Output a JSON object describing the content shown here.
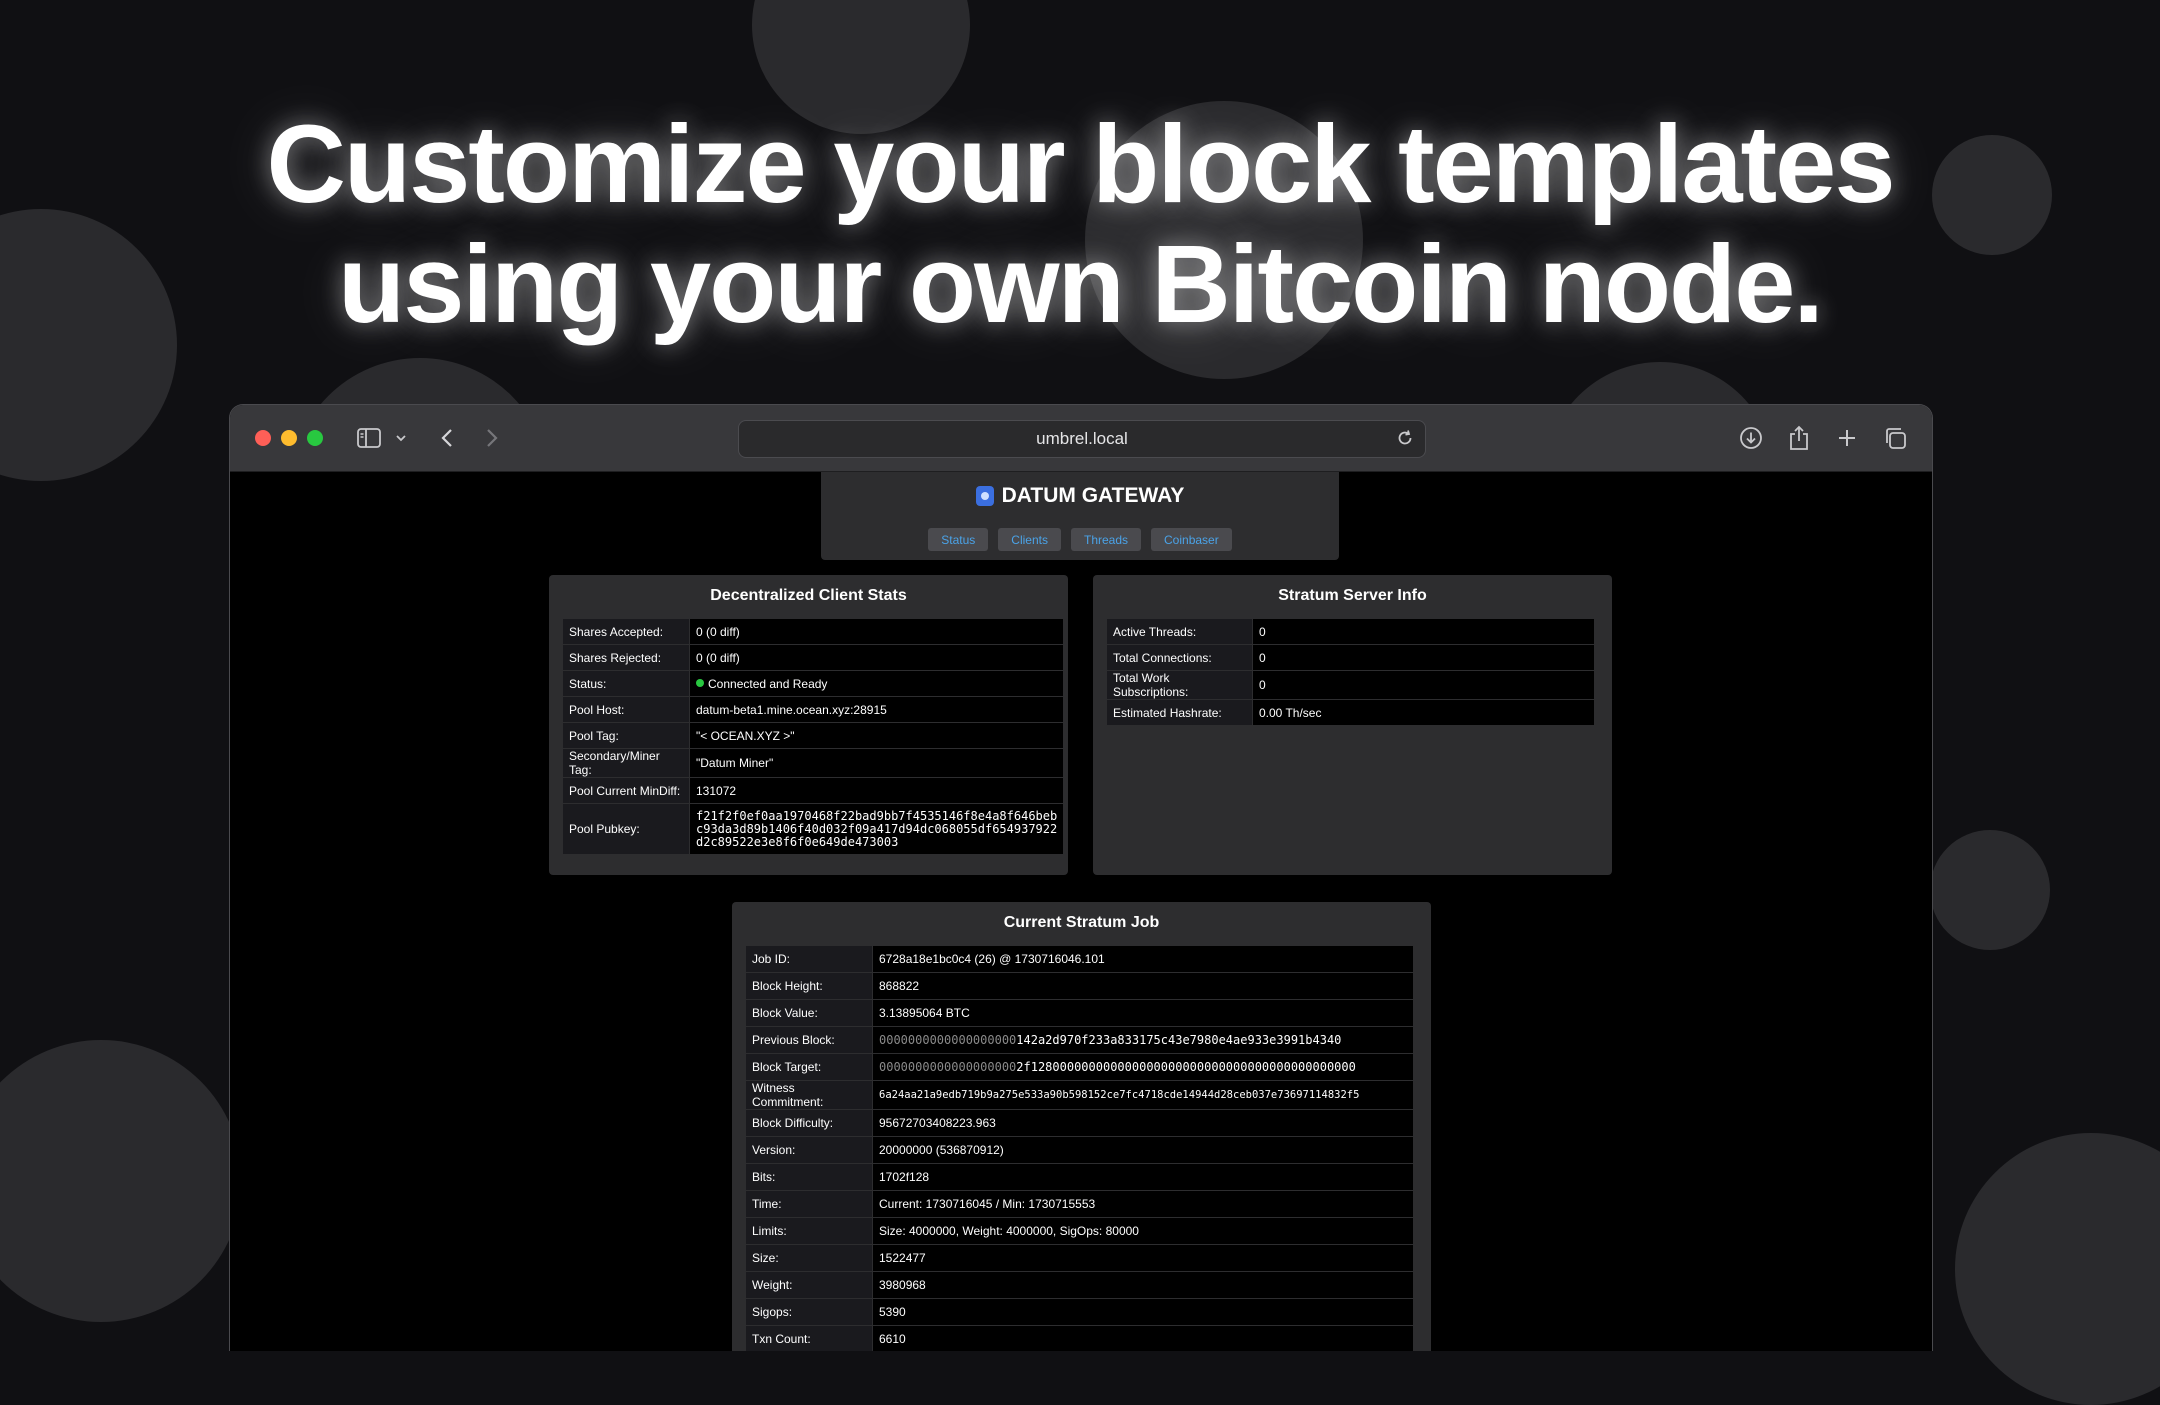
{
  "headline": {
    "line1": "Customize your block templates",
    "line2": "using your own Bitcoin node."
  },
  "browser": {
    "url": "umbrel.local",
    "icons": [
      "sidebar-icon",
      "chevron-down-icon",
      "back-icon",
      "forward-icon",
      "reload-icon",
      "download-icon",
      "share-icon",
      "new-tab-icon",
      "tabs-overview-icon"
    ]
  },
  "gateway": {
    "title": "DATUM GATEWAY",
    "nav": [
      "Status",
      "Clients",
      "Threads",
      "Coinbaser"
    ]
  },
  "client_stats": {
    "title": "Decentralized Client Stats",
    "rows": [
      {
        "k": "Shares Accepted:",
        "v": "0 (0 diff)"
      },
      {
        "k": "Shares Rejected:",
        "v": "0 (0 diff)"
      },
      {
        "k": "Status:",
        "v": "Connected and Ready"
      },
      {
        "k": "Pool Host:",
        "v": "datum-beta1.mine.ocean.xyz:28915"
      },
      {
        "k": "Pool Tag:",
        "v": "\"< OCEAN.XYZ >\""
      },
      {
        "k": "Secondary/Miner Tag:",
        "v": "\"Datum Miner\""
      },
      {
        "k": "Pool Current MinDiff:",
        "v": "131072"
      },
      {
        "k": "Pool Pubkey:",
        "v1": "f21f2f0ef0aa1970468f22bad9bb7f4535146f8e4a8f646beb",
        "v2": "c93da3d89b1406f40d032f09a417d94dc068055df654937922",
        "v3": "d2c89522e3e8f6f0e649de473003"
      }
    ]
  },
  "stratum_info": {
    "title": "Stratum Server Info",
    "rows": [
      {
        "k": "Active Threads:",
        "v": "0"
      },
      {
        "k": "Total Connections:",
        "v": "0"
      },
      {
        "k": "Total Work Subscriptions:",
        "v": "0"
      },
      {
        "k": "Estimated Hashrate:",
        "v": "0.00 Th/sec"
      }
    ]
  },
  "stratum_job": {
    "title": "Current Stratum Job",
    "rows": [
      {
        "k": "Job ID:",
        "v": "6728a18e1bc0c4 (26) @ 1730716046.101"
      },
      {
        "k": "Block Height:",
        "v": "868822"
      },
      {
        "k": "Block Value:",
        "v": "3.13895064 BTC"
      },
      {
        "k": "Previous Block:",
        "zeros": "0000000000000000000",
        "v": "142a2d970f233a833175c43e7980e4ae933e3991b4340"
      },
      {
        "k": "Block Target:",
        "zeros": "0000000000000000000",
        "v": "2f128000000000000000000000000000000000000000000"
      },
      {
        "k": "Witness Commitment:",
        "v": "6a24aa21a9edb719b9a275e533a90b598152ce7fc4718cde14944d28ceb037e73697114832f5"
      },
      {
        "k": "Block Difficulty:",
        "v": "95672703408223.963"
      },
      {
        "k": "Version:",
        "v": "20000000 (536870912)"
      },
      {
        "k": "Bits:",
        "v": "1702f128"
      },
      {
        "k": "Time:",
        "v": "Current: 1730716045 / Min: 1730715553"
      },
      {
        "k": "Limits:",
        "v": "Size: 4000000, Weight: 4000000, SigOps: 80000"
      },
      {
        "k": "Size:",
        "v": "1522477"
      },
      {
        "k": "Weight:",
        "v": "3980968"
      },
      {
        "k": "Sigops:",
        "v": "5390"
      },
      {
        "k": "Txn Count:",
        "v": "6610"
      }
    ]
  }
}
